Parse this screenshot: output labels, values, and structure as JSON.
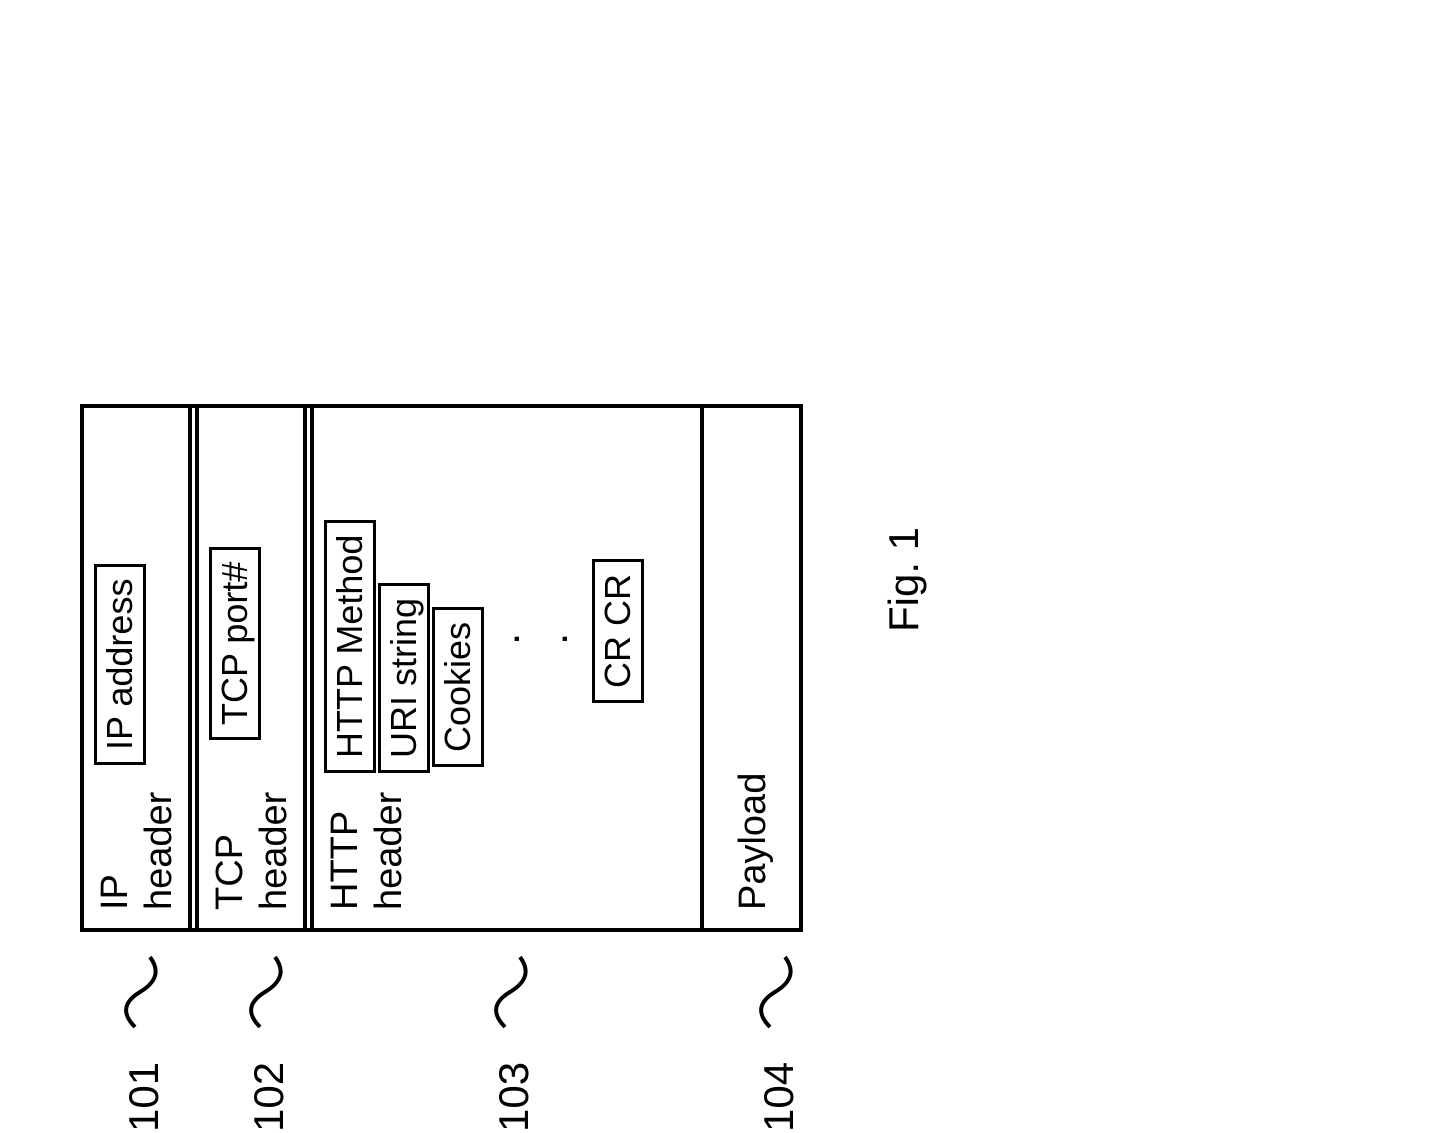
{
  "refs": {
    "ip": "101",
    "tcp": "102",
    "http": "103",
    "payload": "104"
  },
  "sections": {
    "ip": {
      "title_line1": "IP",
      "title_line2": "header",
      "field": "IP address"
    },
    "tcp": {
      "title_line1": "TCP",
      "title_line2": "header",
      "field": "TCP port#"
    },
    "http": {
      "title_line1": "HTTP",
      "title_line2": "header",
      "fields": {
        "method": "HTTP Method",
        "uri": "URI string",
        "cookies": "Cookies",
        "crcr": "CR CR"
      }
    },
    "payload": {
      "title": "Payload"
    }
  },
  "caption": "Fig. 1"
}
